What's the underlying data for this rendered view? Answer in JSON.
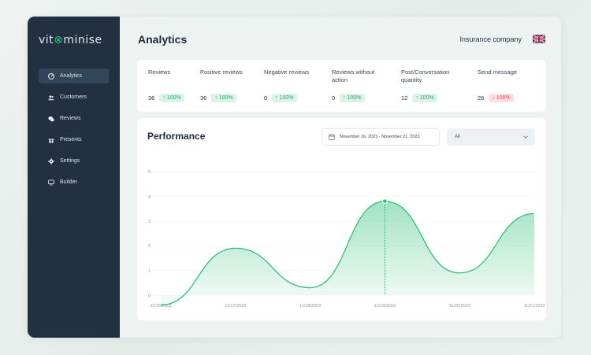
{
  "app": {
    "logo_text_a": "vit",
    "logo_mark": "⊗",
    "logo_text_b": "minise"
  },
  "sidebar": {
    "items": [
      {
        "label": "Analytics",
        "icon": "gauge-icon",
        "active": true
      },
      {
        "label": "Customers",
        "icon": "users-icon"
      },
      {
        "label": "Reviews",
        "icon": "chat-icon"
      },
      {
        "label": "Presents",
        "icon": "gift-icon"
      },
      {
        "label": "Settings",
        "icon": "gear-icon"
      },
      {
        "label": "Builder",
        "icon": "monitor-icon"
      }
    ]
  },
  "header": {
    "title": "Analytics",
    "company": "Insurance company",
    "flag_icon": "uk-flag-icon"
  },
  "stats": [
    {
      "label": "Reviews",
      "value": "36",
      "change": "↑ 100%",
      "trend": "up"
    },
    {
      "label": "Positive reviews",
      "value": "36",
      "change": "↑ 100%",
      "trend": "up"
    },
    {
      "label": "Negative reviews",
      "value": "0",
      "change": "↑ 100%",
      "trend": "up"
    },
    {
      "label": "Reviews without action",
      "value": "0",
      "change": "↑ 100%",
      "trend": "up"
    },
    {
      "label": "Post/Conversation quantity",
      "value": "12",
      "change": "↑ 100%",
      "trend": "up"
    },
    {
      "label": "Send message",
      "value": "26",
      "change": "↓ 100%",
      "trend": "down"
    }
  ],
  "performance": {
    "title": "Performance",
    "date_range": "November 16, 2023 - November 21, 2023",
    "filter_value": "All"
  },
  "colors": {
    "accent": "#2fbf77",
    "sidebar": "#213142",
    "negative": "#e05353"
  },
  "chart_data": {
    "type": "area",
    "categories": [
      "11/16/2023",
      "11/17/2023",
      "11/18/2023",
      "11/19/2023",
      "11/20/2023",
      "11/21/2023"
    ],
    "y_ticks": [
      0,
      1,
      2,
      3,
      4,
      5
    ],
    "ylim": [
      0,
      5
    ],
    "curve_points": [
      {
        "x": "11/16/2023",
        "y": -0.4
      },
      {
        "x": "11/17/2023",
        "y": 1.9
      },
      {
        "x": "11/18/2023",
        "y": 0.3
      },
      {
        "x": "11/19/2023",
        "y": 3.8
      },
      {
        "x": "11/20/2023",
        "y": 0.9
      },
      {
        "x": "11/21/2023",
        "y": 3.3
      }
    ],
    "highlight": {
      "x": "11/19/2023",
      "y": 3.8
    },
    "grid": true,
    "legend": "none"
  }
}
